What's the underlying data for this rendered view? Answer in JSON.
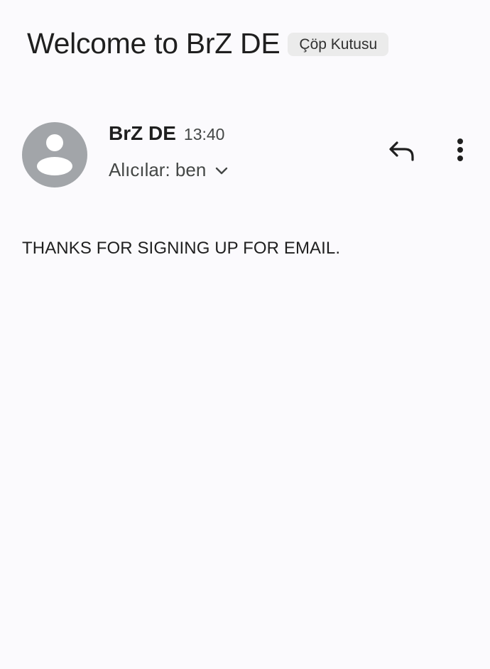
{
  "email": {
    "subject": "Welcome to BrZ DE",
    "label": "Çöp Kutusu",
    "sender": {
      "name": "BrZ DE",
      "time": "13:40",
      "avatar_icon": "person-icon",
      "avatar_color": "#a2a5a9"
    },
    "recipients": "Alıcılar: ben",
    "body": "THANKS FOR SIGNING UP FOR EMAIL."
  },
  "actions": {
    "reply_icon": "reply-icon",
    "more_icon": "more-vert-icon"
  }
}
